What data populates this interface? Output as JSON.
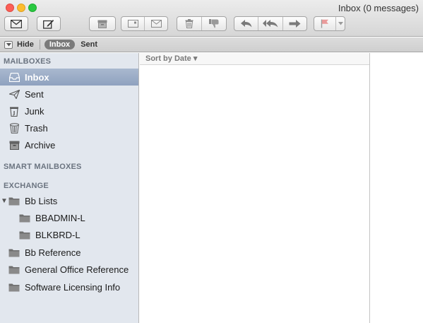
{
  "window": {
    "title": "Inbox (0 messages)"
  },
  "toolbar": {
    "buttons": [
      {
        "name": "get-mail-button",
        "icon": "envelope-icon"
      },
      {
        "name": "compose-button",
        "icon": "compose-icon"
      },
      {
        "name": "archive-button",
        "icon": "archive-box-icon"
      },
      {
        "name": "move-button",
        "icon": "move-to-mailbox-icon"
      },
      {
        "name": "delete-button",
        "icon": "trash-icon"
      },
      {
        "name": "junk-button",
        "icon": "thumbs-down-icon"
      },
      {
        "name": "reply-button",
        "icon": "reply-icon"
      },
      {
        "name": "reply-all-button",
        "icon": "reply-all-icon"
      },
      {
        "name": "forward-button",
        "icon": "forward-icon"
      },
      {
        "name": "flag-button",
        "icon": "flag-icon"
      }
    ]
  },
  "favorites": {
    "hide_label": "Hide",
    "items": [
      "Inbox",
      "Sent"
    ]
  },
  "sidebar": {
    "mailboxes_header": "MAILBOXES",
    "mailboxes": [
      {
        "label": "Inbox",
        "icon": "inbox-tray-icon",
        "selected": true
      },
      {
        "label": "Sent",
        "icon": "paper-plane-icon"
      },
      {
        "label": "Junk",
        "icon": "junk-bin-icon"
      },
      {
        "label": "Trash",
        "icon": "trash-icon"
      },
      {
        "label": "Archive",
        "icon": "archive-box-icon"
      }
    ],
    "smart_header": "SMART MAILBOXES",
    "exchange_header": "EXCHANGE",
    "folders": [
      {
        "label": "Bb Lists",
        "icon": "folder-icon",
        "expanded": true
      },
      {
        "label": "BBADMIN-L",
        "icon": "folder-icon",
        "child": true
      },
      {
        "label": "BLKBRD-L",
        "icon": "folder-icon",
        "child": true
      },
      {
        "label": "Bb Reference",
        "icon": "folder-icon"
      },
      {
        "label": "General Office Reference",
        "icon": "folder-icon"
      },
      {
        "label": "Software Licensing Info",
        "icon": "folder-icon"
      }
    ]
  },
  "message_list": {
    "sort_label": "Sort by Date ▾"
  },
  "colors": {
    "sidebar_bg": "#e2e7ee",
    "selection": "#98a9c3"
  }
}
